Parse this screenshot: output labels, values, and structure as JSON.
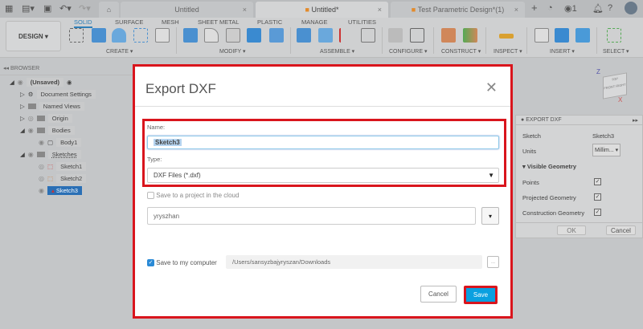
{
  "tabs": [
    {
      "label": "Untitled"
    },
    {
      "label": "Untitled*"
    },
    {
      "label": "Test Parametric Design*(1)"
    }
  ],
  "topbar": {
    "job_count": "1"
  },
  "toolbar": {
    "workspace": "DESIGN ▾",
    "menu_tabs": [
      "SOLID",
      "SURFACE",
      "MESH",
      "SHEET METAL",
      "PLASTIC",
      "MANAGE",
      "UTILITIES"
    ],
    "groups": [
      "CREATE ▾",
      "MODIFY ▾",
      "ASSEMBLE ▾",
      "CONFIGURE ▾",
      "CONSTRUCT ▾",
      "INSPECT ▾",
      "INSERT ▾",
      "SELECT ▾"
    ]
  },
  "browser": {
    "title": "BROWSER",
    "nodes": [
      "(Unsaved)",
      "Document Settings",
      "Named Views",
      "Origin",
      "Bodies",
      "Body1",
      "Sketches",
      "Sketch1",
      "Sketch2",
      "Sketch3"
    ]
  },
  "viewcube": {
    "axis_z": "Z",
    "axis_x": "X",
    "faces": [
      "TOP",
      "FRONT",
      "RIGHT"
    ]
  },
  "dialog": {
    "title": "Export DXF",
    "name_label": "Name:",
    "name_value": "Sketch3",
    "type_label": "Type:",
    "type_value": "DXF Files (*.dxf)",
    "cloud_label": "Save to a project in the cloud",
    "cloud_checked": false,
    "project_value": "yryszhan",
    "computer_label": "Save to my computer",
    "computer_checked": true,
    "path_value": "/Users/sansyzbajyryszan/Downloads",
    "browse_label": "...",
    "cancel": "Cancel",
    "save": "Save"
  },
  "panel": {
    "title": "EXPORT DXF",
    "sketch_label": "Sketch",
    "sketch_value": "Sketch3",
    "units_label": "Units",
    "units_value": "Millim... ▾",
    "section": "Visible Geometry",
    "options": [
      {
        "label": "Points",
        "checked": true
      },
      {
        "label": "Projected Geometry",
        "checked": true
      },
      {
        "label": "Construction Geometry",
        "checked": true
      }
    ],
    "ok": "OK",
    "cancel": "Cancel"
  },
  "colors": {
    "accent": "#2f7fb8",
    "highlight": "#d9151d",
    "save_button": "#0aa0e0"
  }
}
